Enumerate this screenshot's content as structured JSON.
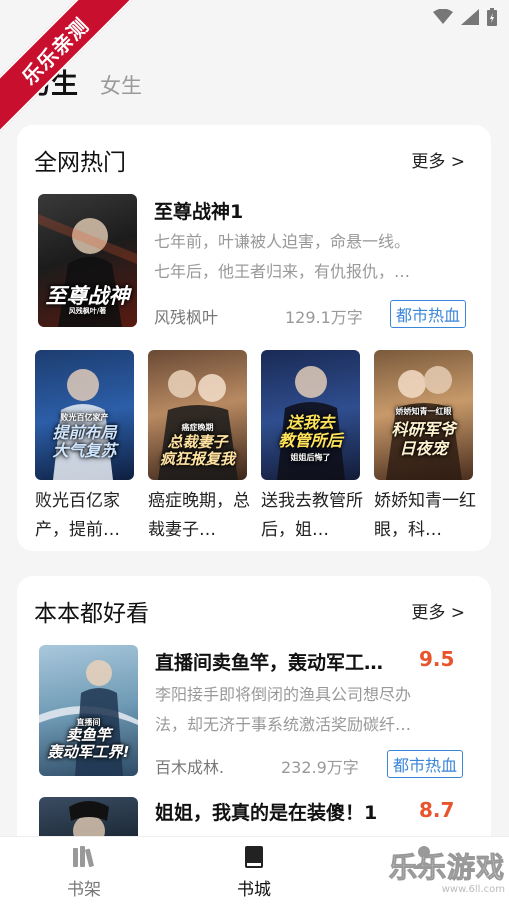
{
  "ribbon": {
    "text": "乐乐亲测"
  },
  "tabs": {
    "male": "男生",
    "female": "女生"
  },
  "section1": {
    "title": "全网热门",
    "more": "更多 >",
    "featured": {
      "cover_text": "至尊战神",
      "cover_sub": "风残枫叶/著",
      "title": "至尊战神1",
      "desc_line1": "七年前，叶谦被人迫害，命悬一线。",
      "desc_line2": "七年后，他王者归来，有仇报仇，…",
      "author": "风残枫叶",
      "words": "129.1万字",
      "tag": "都市热血"
    },
    "grid": [
      {
        "cover_text": "提前布局\n大气复苏",
        "cover_small": "败光百亿家产",
        "title": "败光百亿家产，提前…"
      },
      {
        "cover_text": "总裁妻子\n疯狂报复我",
        "cover_small": "癌症晚期",
        "title": "癌症晚期，总裁妻子…"
      },
      {
        "cover_text": "送我去\n教管所后",
        "cover_small": "姐姐后悔了",
        "title": "送我去教管所后，姐…"
      },
      {
        "cover_text": "科研军爷\n日夜宠",
        "cover_small": "娇娇知青一红眼",
        "title": "娇娇知青一红眼，科…"
      }
    ]
  },
  "section2": {
    "title": "本本都好看",
    "more": "更多 >",
    "books": [
      {
        "cover_text": "卖鱼竿\n轰动军工界!",
        "cover_small": "直播间",
        "title": "直播间卖鱼竿，轰动军工…",
        "score": "9.5",
        "desc_line1": "李阳接手即将倒闭的渔具公司想尽办",
        "desc_line2": "法，却无济于事系统激活奖励碳纤…",
        "author": "百木成林.",
        "words": "232.9万字",
        "tag": "都市热血"
      },
      {
        "title": "姐姐，我真的是在装傻！1",
        "score": "8.7"
      }
    ]
  },
  "nav": {
    "shelf": "书架",
    "store": "书城"
  },
  "watermark": {
    "main": "乐乐游戏",
    "sub": "www.6ll.com"
  },
  "colors": {
    "accent": "#3a86d8",
    "score": "#e8552c",
    "ribbon": "#c8102e"
  }
}
